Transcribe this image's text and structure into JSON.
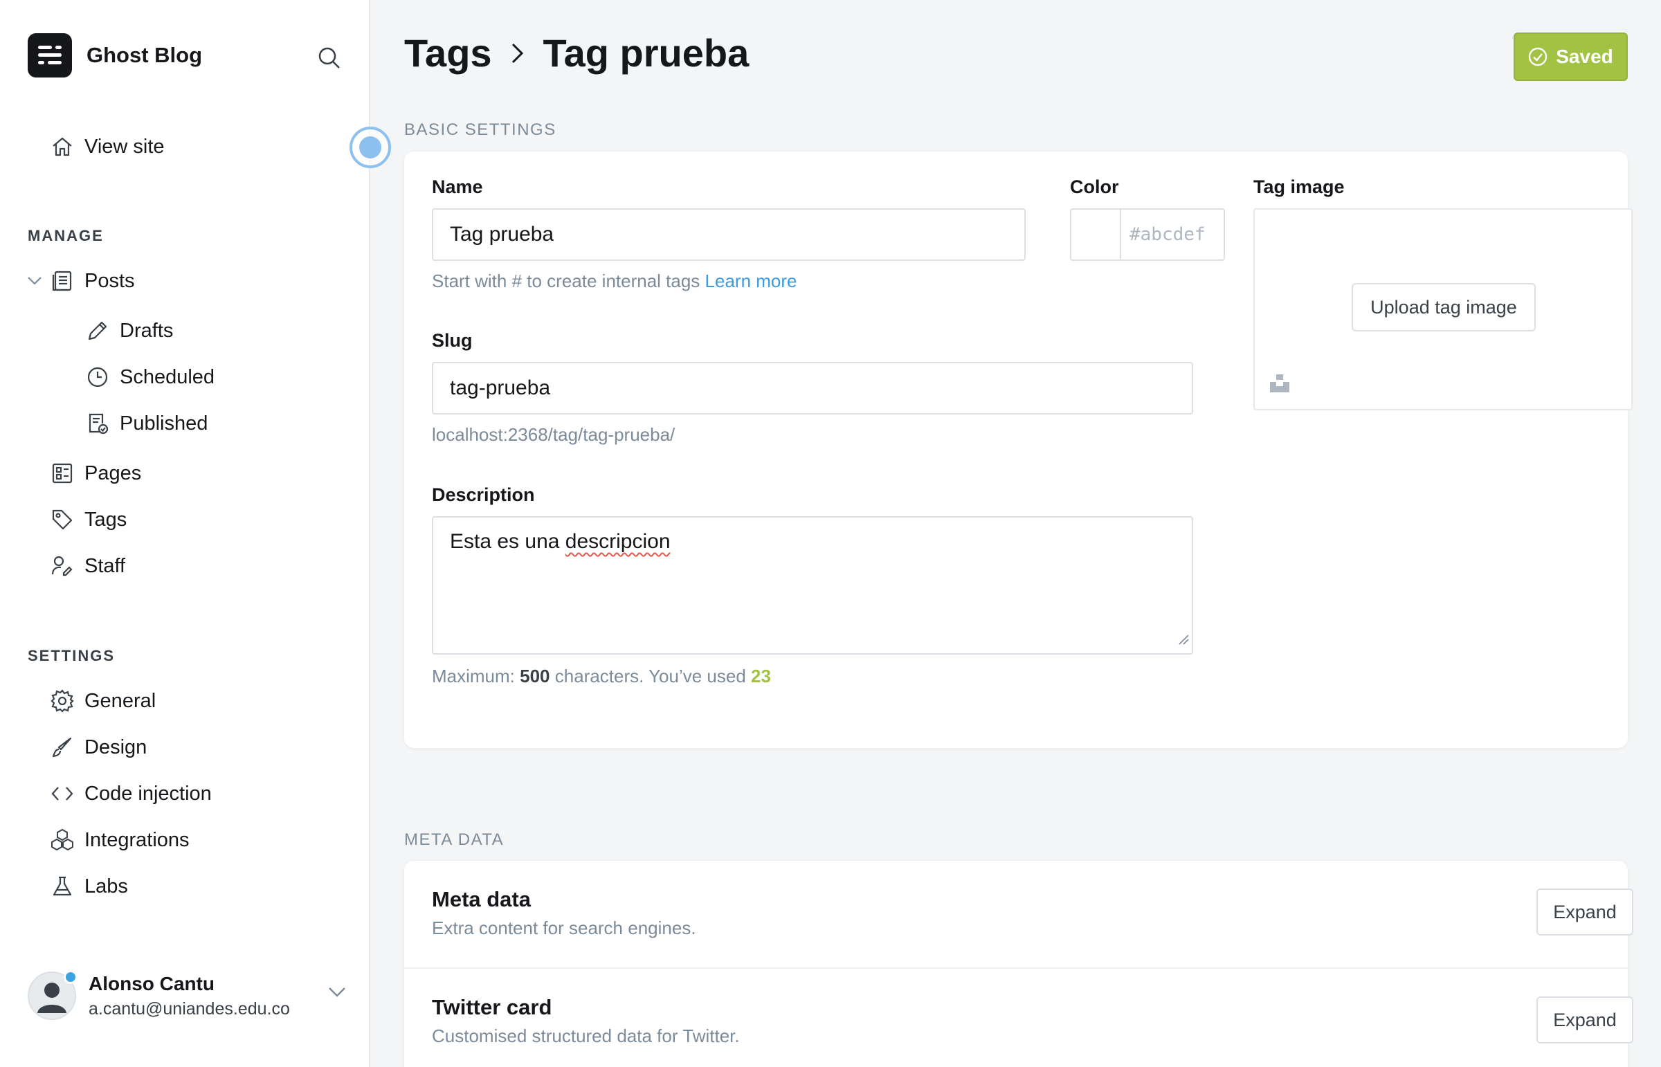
{
  "sidebar": {
    "brand_name": "Ghost Blog",
    "view_site": "View site",
    "manage_label": "MANAGE",
    "posts": "Posts",
    "drafts": "Drafts",
    "scheduled": "Scheduled",
    "published": "Published",
    "pages": "Pages",
    "tags": "Tags",
    "staff": "Staff",
    "settings_label": "SETTINGS",
    "general": "General",
    "design": "Design",
    "code_injection": "Code injection",
    "integrations": "Integrations",
    "labs": "Labs"
  },
  "user": {
    "name": "Alonso Cantu",
    "email": "a.cantu@uniandes.edu.co"
  },
  "header": {
    "crumb_parent": "Tags",
    "crumb_current": "Tag prueba",
    "saved_label": "Saved"
  },
  "basic": {
    "section_title": "BASIC SETTINGS",
    "name_label": "Name",
    "name_value": "Tag prueba",
    "name_hint": "Start with # to create internal tags",
    "learn_more": "Learn more",
    "color_label": "Color",
    "color_placeholder": "#abcdef",
    "image_label": "Tag image",
    "upload_label": "Upload tag image",
    "slug_label": "Slug",
    "slug_value": "tag-prueba",
    "slug_url": "localhost:2368/tag/tag-prueba/",
    "desc_label": "Description",
    "desc_prefix": "Esta es una ",
    "desc_misspelled": "descripcion",
    "max_prefix": "Maximum: ",
    "max_value": "500",
    "max_middle": " characters. You’ve used ",
    "used_value": "23"
  },
  "meta": {
    "section_title": "META DATA",
    "rows": [
      {
        "title": "Meta data",
        "desc": "Extra content for search engines.",
        "button": "Expand"
      },
      {
        "title": "Twitter card",
        "desc": "Customised structured data for Twitter.",
        "button": "Expand"
      }
    ]
  },
  "colors": {
    "accent_green": "#a2c243",
    "link_blue": "#3c9ae0",
    "text_dark": "#15171a",
    "text_muted": "#7c8b9a"
  }
}
